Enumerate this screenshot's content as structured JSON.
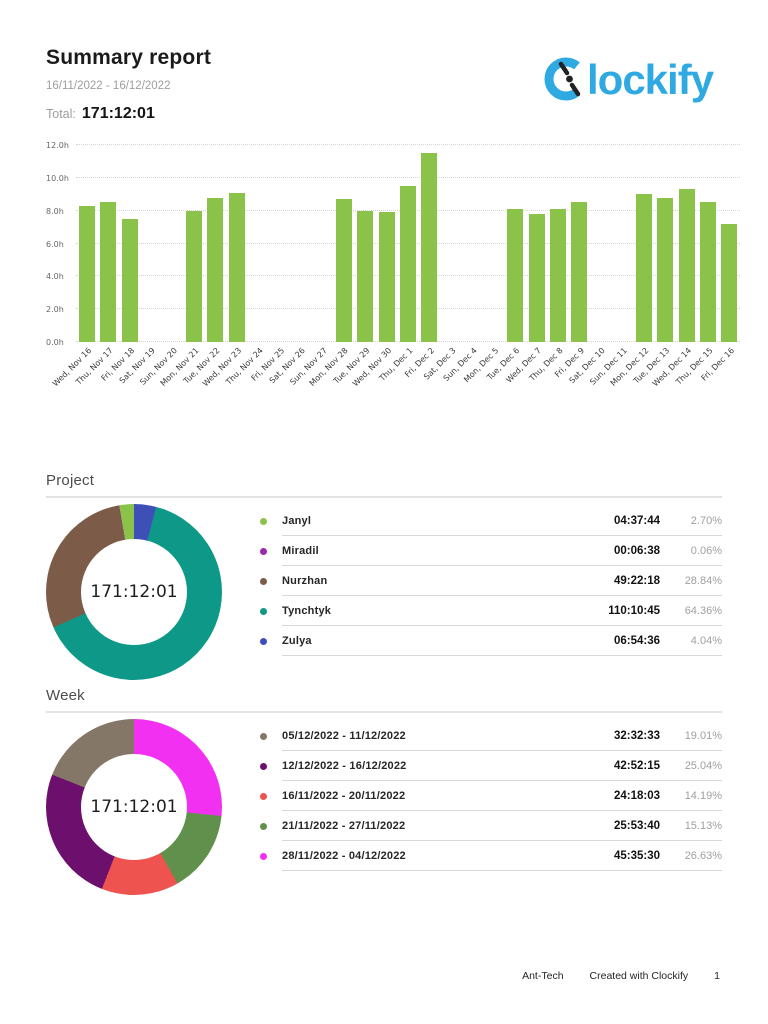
{
  "page": {
    "title": "Summary report",
    "date_range": "16/11/2022 - 16/12/2022",
    "total_label": "Total:",
    "total_value": "171:12:01"
  },
  "logo": {
    "name": "Clockify",
    "wordmark_rest": "lockify",
    "brand_color": "#2ea9e1"
  },
  "chart_data": [
    {
      "type": "bar",
      "title": "Tracked time per day",
      "xlabel": "",
      "ylabel": "hours",
      "ylim": [
        0,
        12
      ],
      "grid": true,
      "bar_color": "#8bc34a",
      "yticks": [
        "0.0h",
        "2.0h",
        "4.0h",
        "6.0h",
        "8.0h",
        "10.0h",
        "12.0h"
      ],
      "categories": [
        "Wed, Nov 16",
        "Thu, Nov 17",
        "Fri, Nov 18",
        "Sat, Nov 19",
        "Sun, Nov 20",
        "Mon, Nov 21",
        "Tue, Nov 22",
        "Wed, Nov 23",
        "Thu, Nov 24",
        "Fri, Nov 25",
        "Sat, Nov 26",
        "Sun, Nov 27",
        "Mon, Nov 28",
        "Tue, Nov 29",
        "Wed, Nov 30",
        "Thu, Dec 1",
        "Fri, Dec 2",
        "Sat, Dec 3",
        "Sun, Dec 4",
        "Mon, Dec 5",
        "Tue, Dec 6",
        "Wed, Dec 7",
        "Thu, Dec 8",
        "Fri, Dec 9",
        "Sat, Dec 10",
        "Sun, Dec 11",
        "Mon, Dec 12",
        "Tue, Dec 13",
        "Wed, Dec 14",
        "Thu, Dec 15",
        "Fri, Dec 16"
      ],
      "values": [
        8.3,
        8.5,
        7.5,
        0,
        0,
        8.0,
        8.8,
        9.1,
        0,
        0,
        0,
        0,
        8.7,
        8.0,
        7.9,
        9.5,
        11.5,
        0,
        0,
        0,
        8.1,
        7.8,
        8.1,
        8.5,
        0,
        0,
        9.0,
        8.8,
        9.3,
        8.5,
        7.2
      ]
    },
    {
      "type": "donut",
      "title": "Project",
      "center_label": "171:12:01",
      "legend_position": "right",
      "legend": [
        {
          "label": "Janyl",
          "time": "04:37:44",
          "percent": "2.70%",
          "pct": 2.7,
          "color": "#8bc34a"
        },
        {
          "label": "Miradil",
          "time": "00:06:38",
          "percent": "0.06%",
          "pct": 0.06,
          "color": "#9c27b0"
        },
        {
          "label": "Nurzhan",
          "time": "49:22:18",
          "percent": "28.84%",
          "pct": 28.84,
          "color": "#7d5b49"
        },
        {
          "label": "Tynchtyk",
          "time": "110:10:45",
          "percent": "64.36%",
          "pct": 64.36,
          "color": "#0e9888"
        },
        {
          "label": "Zulya",
          "time": "06:54:36",
          "percent": "4.04%",
          "pct": 4.04,
          "color": "#3e4fb8"
        }
      ],
      "draw_order_clockwise_from_top": [
        4,
        3,
        2,
        1,
        0
      ]
    },
    {
      "type": "donut",
      "title": "Week",
      "center_label": "171:12:01",
      "legend_position": "right",
      "legend": [
        {
          "label": "05/12/2022 - 11/12/2022",
          "time": "32:32:33",
          "percent": "19.01%",
          "pct": 19.01,
          "color": "#857768"
        },
        {
          "label": "12/12/2022 - 16/12/2022",
          "time": "42:52:15",
          "percent": "25.04%",
          "pct": 25.04,
          "color": "#6d106d"
        },
        {
          "label": "16/11/2022 - 20/11/2022",
          "time": "24:18:03",
          "percent": "14.19%",
          "pct": 14.19,
          "color": "#ef5350"
        },
        {
          "label": "21/11/2022 - 27/11/2022",
          "time": "25:53:40",
          "percent": "15.13%",
          "pct": 15.13,
          "color": "#61904c"
        },
        {
          "label": "28/11/2022 - 04/12/2022",
          "time": "45:35:30",
          "percent": "26.63%",
          "pct": 26.63,
          "color": "#f230f2"
        }
      ],
      "draw_order_clockwise_from_top": [
        4,
        3,
        2,
        1,
        0
      ]
    }
  ],
  "footer": {
    "workspace": "Ant-Tech",
    "created_with": "Created with Clockify",
    "page_number": "1"
  }
}
